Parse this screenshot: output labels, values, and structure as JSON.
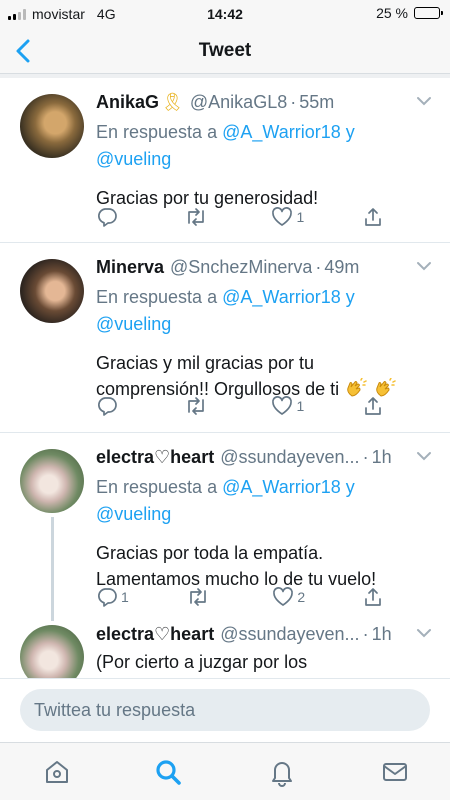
{
  "status": {
    "carrier": "movistar",
    "network": "4G",
    "time": "14:42",
    "battery": "25 %",
    "battery_level": 0.25
  },
  "nav": {
    "title": "Tweet",
    "back_icon": "chevron-left-icon"
  },
  "colors": {
    "accent": "#1da1f2",
    "muted": "#657786",
    "text": "#14171a",
    "divider": "#e1e8ed"
  },
  "tweets": [
    {
      "name": "AnikaG",
      "badge": "🎗",
      "handle": "@AnikaGL8",
      "sep": "·",
      "time": "55m",
      "reply_prefix": "En respuesta a",
      "reply_user1": "@A_Warrior18",
      "reply_and": "y",
      "reply_user2": "@vueling",
      "text": "Gracias por tu generosidad!",
      "reply_count": "",
      "retweet_count": "",
      "like_count": "1"
    },
    {
      "name": "Minerva",
      "handle": "@SnchezMinerva",
      "sep": "·",
      "time": "49m",
      "reply_prefix": "En respuesta a",
      "reply_user1": "@A_Warrior18",
      "reply_and": "y",
      "reply_user2": "@vueling",
      "text_line1": "Gracias y mil gracias por tu",
      "text_line2": "comprensión!! Orgullosos de ti",
      "emoji": "clapping-hands",
      "reply_count": "",
      "retweet_count": "",
      "like_count": "1"
    },
    {
      "name": "electra♡heart",
      "handle": "@ssundayeven...",
      "sep": "·",
      "time": "1h",
      "reply_prefix": "En respuesta a",
      "reply_user1": "@A_Warrior18",
      "reply_and": "y",
      "reply_user2": "@vueling",
      "text_line1": "Gracias por toda la empatía.",
      "text_line2": "Lamentamos mucho lo de tu vuelo!",
      "reply_count": "1",
      "retweet_count": "",
      "like_count": "2"
    },
    {
      "name": "electra♡heart",
      "handle": "@ssundayeven...",
      "sep": "·",
      "time": "1h",
      "text": "(Por cierto a juzgar por los"
    }
  ],
  "compose": {
    "placeholder": "Twittea tu respuesta"
  },
  "tabs": [
    "home-icon",
    "search-icon",
    "notifications-icon",
    "messages-icon"
  ]
}
